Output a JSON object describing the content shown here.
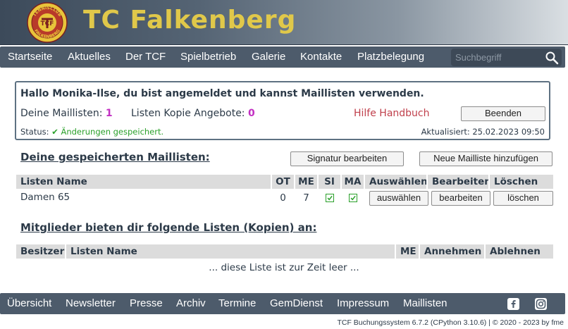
{
  "header": {
    "title": "TC Falkenberg",
    "logo": {
      "text_top": "TENNISCLUB",
      "text_center": "TCF",
      "text_bottom": "FALKENBERG"
    }
  },
  "nav": {
    "items": [
      "Startseite",
      "Aktuelles",
      "Der TCF",
      "Spielbetrieb",
      "Galerie",
      "Kontakte",
      "Platzbelegung"
    ],
    "search_placeholder": "Suchbegriff",
    "search_icon": "search-icon"
  },
  "panel": {
    "greeting": "Hallo Monika-Ilse, du bist angemeldet und kannst Maillisten verwenden.",
    "my_lists_label": "Deine Maillisten:",
    "my_lists_count": "1",
    "copy_offers_label": "Listen Kopie Angebote:",
    "copy_offers_count": "0",
    "help_link": "Hilfe Handbuch",
    "logout_button": "Beenden",
    "status_label": "Status:",
    "status_message": "✔ Änderungen gespeichert.",
    "updated": "Aktualisiert: 25.02.2023 09:50"
  },
  "saved_lists": {
    "title": "Deine gespeicherten Maillisten:",
    "signature_button": "Signatur bearbeiten",
    "add_button": "Neue Mailliste hinzufügen",
    "columns": [
      "Listen Name",
      "OT",
      "ME",
      "SI",
      "MA",
      "Auswählen",
      "Bearbeiten",
      "Löschen"
    ],
    "rows": [
      {
        "name": "Damen 65",
        "ot": "0",
        "me": "7",
        "si": true,
        "ma": true,
        "select": "auswählen",
        "edit": "bearbeiten",
        "delete": "löschen"
      }
    ]
  },
  "offers": {
    "title": "Mitglieder bieten dir folgende Listen (Kopien) an:",
    "columns": [
      "Besitzer",
      "Listen Name",
      "ME",
      "Annehmen",
      "Ablehnen"
    ],
    "empty_message": "... diese Liste ist zur Zeit leer ..."
  },
  "footer": {
    "items": [
      "Übersicht",
      "Newsletter",
      "Presse",
      "Archiv",
      "Termine",
      "GemDienst",
      "Impressum",
      "Maillisten"
    ],
    "social": [
      "facebook-icon",
      "instagram-icon"
    ],
    "credits": "TCF Buchungssystem 6.7.2 (CPython 3.10.6) | © 2020 - 2023 by fme"
  },
  "colors": {
    "accent_title": "#e0c84a",
    "nav_bg": "#4d5b6b",
    "count": "#c22fc2",
    "help": "#c0404c",
    "ok": "#2aa02a"
  }
}
